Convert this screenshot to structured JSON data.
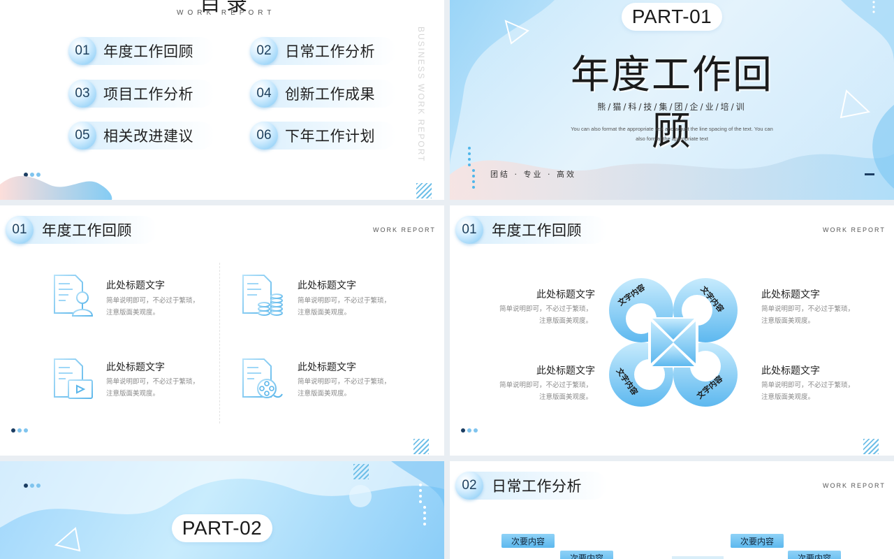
{
  "toc": {
    "title": "目录",
    "subtitle": "WORK REPORT",
    "side_text": "BUSINESS WORK REPORT",
    "items": [
      {
        "num": "01",
        "label": "年度工作回顾"
      },
      {
        "num": "02",
        "label": "日常工作分析"
      },
      {
        "num": "03",
        "label": "项目工作分析"
      },
      {
        "num": "04",
        "label": "创新工作成果"
      },
      {
        "num": "05",
        "label": "相关改进建议"
      },
      {
        "num": "06",
        "label": "下年工作计划"
      }
    ]
  },
  "cover1": {
    "part": "PART-01",
    "title": "年度工作回顾",
    "company": "熊/猫/科/技/集/团/企/业/培/训",
    "desc": "You can also format the appropriate text and adjust the line spacing of the text. You can also format the appropriate text",
    "motto": "团结 · 专业 · 高效"
  },
  "review1": {
    "num": "01",
    "title": "年度工作回顾",
    "work_report": "WORK REPORT",
    "cards": [
      {
        "title": "此处标题文字",
        "desc1": "简单说明即可，不必过于繁琐，",
        "desc2": "注意版面美观度。",
        "icon": "document-user-icon"
      },
      {
        "title": "此处标题文字",
        "desc1": "简单说明即可，不必过于繁琐，",
        "desc2": "注意版面美观度。",
        "icon": "document-coins-icon"
      },
      {
        "title": "此处标题文字",
        "desc1": "简单说明即可，不必过于繁琐，",
        "desc2": "注意版面美观度。",
        "icon": "document-video-icon"
      },
      {
        "title": "此处标题文字",
        "desc1": "简单说明即可，不必过于繁琐，",
        "desc2": "注意版面美观度。",
        "icon": "document-film-icon"
      }
    ]
  },
  "review2": {
    "num": "01",
    "title": "年度工作回顾",
    "work_report": "WORK REPORT",
    "petal_text": "文字内容",
    "blocks": [
      {
        "title": "此处标题文字",
        "desc1": "简单说明即可，不必过于繁琐，",
        "desc2": "注意版面美观度。"
      },
      {
        "title": "此处标题文字",
        "desc1": "简单说明即可，不必过于繁琐，",
        "desc2": "注意版面美观度。"
      },
      {
        "title": "此处标题文字",
        "desc1": "简单说明即可，不必过于繁琐，",
        "desc2": "注意版面美观度。"
      },
      {
        "title": "此处标题文字",
        "desc1": "简单说明即可，不必过于繁琐，",
        "desc2": "注意版面美观度。"
      }
    ]
  },
  "cover2": {
    "part": "PART-02"
  },
  "daily": {
    "num": "02",
    "title": "日常工作分析",
    "work_report": "WORK REPORT",
    "sub_label": "次要内容"
  },
  "colors": {
    "accent": "#5cb8ee",
    "dark": "#1b3d62",
    "light": "#c9ecfd"
  }
}
